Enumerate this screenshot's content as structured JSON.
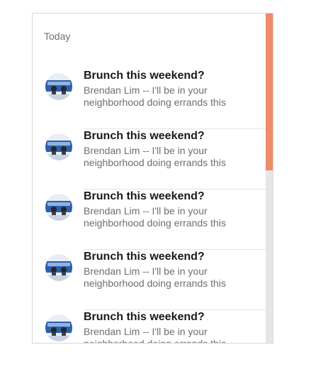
{
  "list": {
    "subheader": "Today",
    "items": [
      {
        "primary": "Brunch this weekend?",
        "secondary": "Brendan Lim -- I'll be in your neighborhood doing errands this",
        "avatar": "avatar-photo"
      },
      {
        "primary": "Brunch this weekend?",
        "secondary": "Brendan Lim -- I'll be in your neighborhood doing errands this",
        "avatar": "avatar-photo"
      },
      {
        "primary": "Brunch this weekend?",
        "secondary": "Brendan Lim -- I'll be in your neighborhood doing errands this",
        "avatar": "avatar-photo"
      },
      {
        "primary": "Brunch this weekend?",
        "secondary": "Brendan Lim -- I'll be in your neighborhood doing errands this",
        "avatar": "avatar-photo"
      },
      {
        "primary": "Brunch this weekend?",
        "secondary": "Brendan Lim -- I'll be in your neighborhood doing errands this",
        "avatar": "avatar-photo"
      }
    ]
  },
  "colors": {
    "scrollbar_thumb": "#ee8c68",
    "scrollbar_track": "#e6e6e6"
  }
}
